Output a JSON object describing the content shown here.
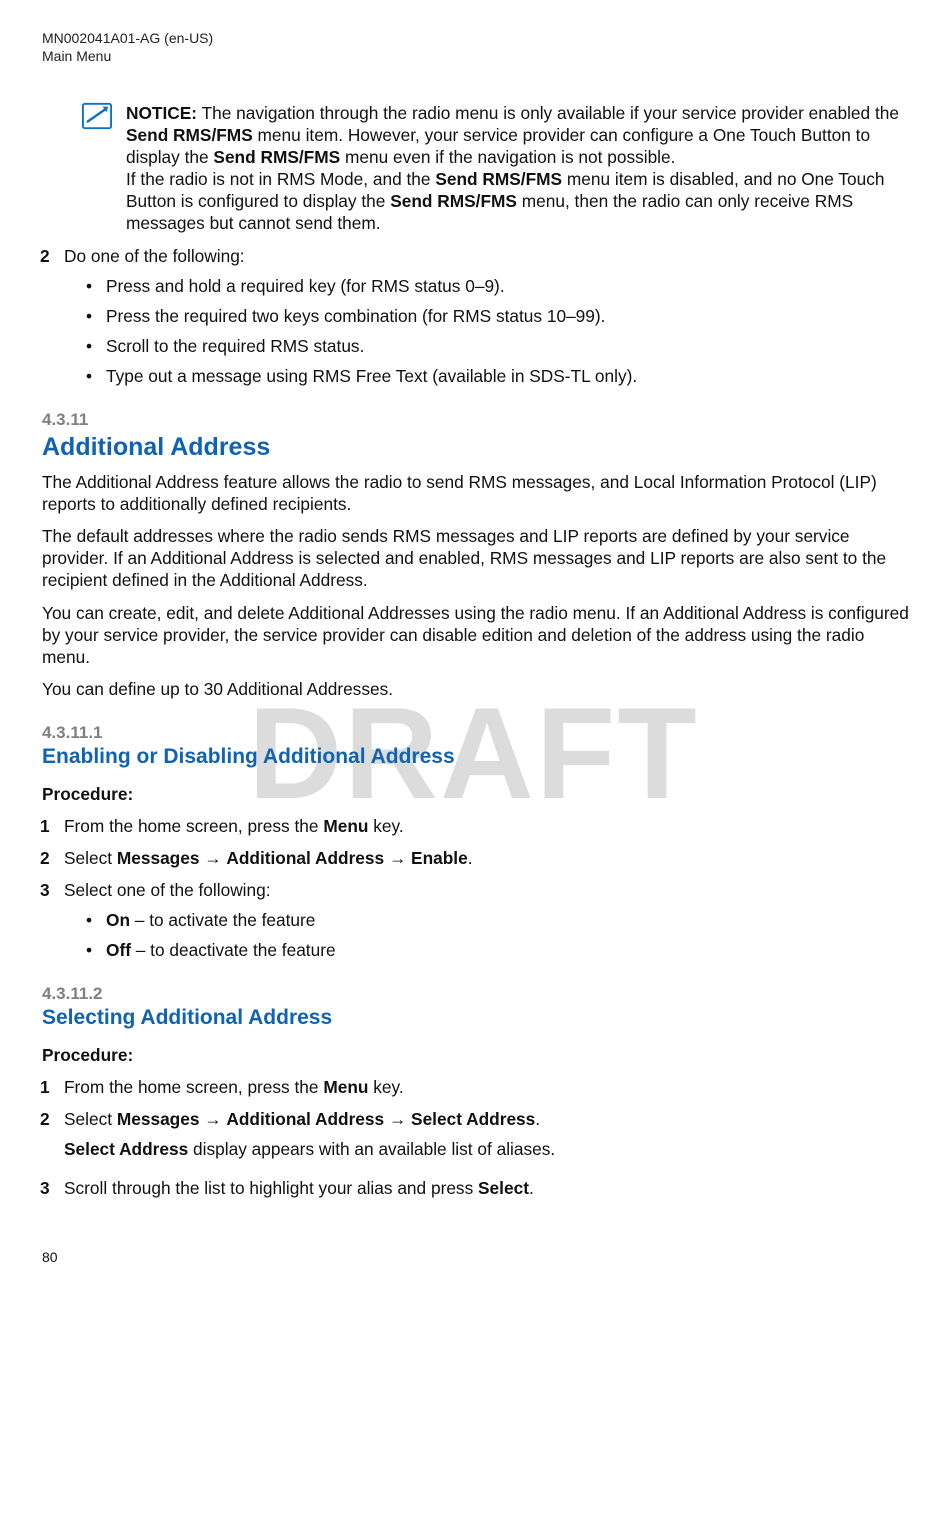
{
  "header": {
    "doc_id": "MN002041A01-AG (en-US)",
    "section": "Main Menu"
  },
  "watermark": "DRAFT",
  "page_number": "80",
  "notice": {
    "label": "NOTICE:",
    "line1a": " The navigation through the radio menu is only available if your service provider enabled the ",
    "bold1": "Send RMS/FMS",
    "line1b": " menu item. However, your service provider can configure a One Touch Button to display the ",
    "bold2": "Send RMS/FMS",
    "line1c": " menu even if the navigation is not possible.",
    "line2a": "If the radio is not in RMS Mode, and the ",
    "bold3": "Send RMS/FMS",
    "line2b": " menu item is disabled, and no One Touch Button is configured to display the ",
    "bold4": "Send RMS/FMS",
    "line2c": " menu, then the radio can only receive RMS messages but cannot send them."
  },
  "step2": {
    "num": "2",
    "text": "Do one of the following:",
    "bullets": [
      "Press and hold a required key (for RMS status 0–9).",
      "Press the required two keys combination (for RMS status 10–99).",
      "Scroll to the required RMS status.",
      "Type out a message using RMS Free Text (available in SDS-TL only)."
    ]
  },
  "sec_4_3_11": {
    "num": "4.3.11",
    "title": "Additional Address",
    "p1": "The Additional Address feature allows the radio to send RMS messages, and Local Information Protocol (LIP) reports to additionally defined recipients.",
    "p2": "The default addresses where the radio sends RMS messages and LIP reports are defined by your service provider. If an Additional Address is selected and enabled, RMS messages and LIP reports are also sent to the recipient defined in the Additional Address.",
    "p3": "You can create, edit, and delete Additional Addresses using the radio menu. If an Additional Address is configured by your service provider, the service provider can disable edition and deletion of the address using the radio menu.",
    "p4": "You can define up to 30 Additional Addresses."
  },
  "sec_4_3_11_1": {
    "num": "4.3.11.1",
    "title": "Enabling or Disabling Additional Address",
    "procedure_label": "Procedure:",
    "steps": [
      {
        "n": "1",
        "pre": "From the home screen, press the ",
        "b": "Menu",
        "post": " key."
      },
      {
        "n": "2",
        "pre": "Select ",
        "b1": "Messages",
        "arrow1": " → ",
        "b2": "Additional Address",
        "arrow2": " → ",
        "b3": "Enable",
        "post": "."
      },
      {
        "n": "3",
        "text": "Select one of the following:"
      }
    ],
    "sub_bullets": {
      "on_b": "On",
      "on_t": " – to activate the feature",
      "off_b": "Off",
      "off_t": " – to deactivate the feature"
    }
  },
  "sec_4_3_11_2": {
    "num": "4.3.11.2",
    "title": "Selecting Additional Address",
    "procedure_label": "Procedure:",
    "steps": [
      {
        "n": "1",
        "pre": "From the home screen, press the ",
        "b": "Menu",
        "post": " key."
      },
      {
        "n": "2",
        "pre": "Select ",
        "b1": "Messages",
        "arrow1": " → ",
        "b2": "Additional Address",
        "arrow2": " → ",
        "b3": "Select Address",
        "post": ".",
        "sub_b": "Select Address",
        "sub_t": " display appears with an available list of aliases."
      },
      {
        "n": "3",
        "pre": "Scroll through the list to highlight your alias and press ",
        "b": "Select",
        "post": "."
      }
    ]
  }
}
